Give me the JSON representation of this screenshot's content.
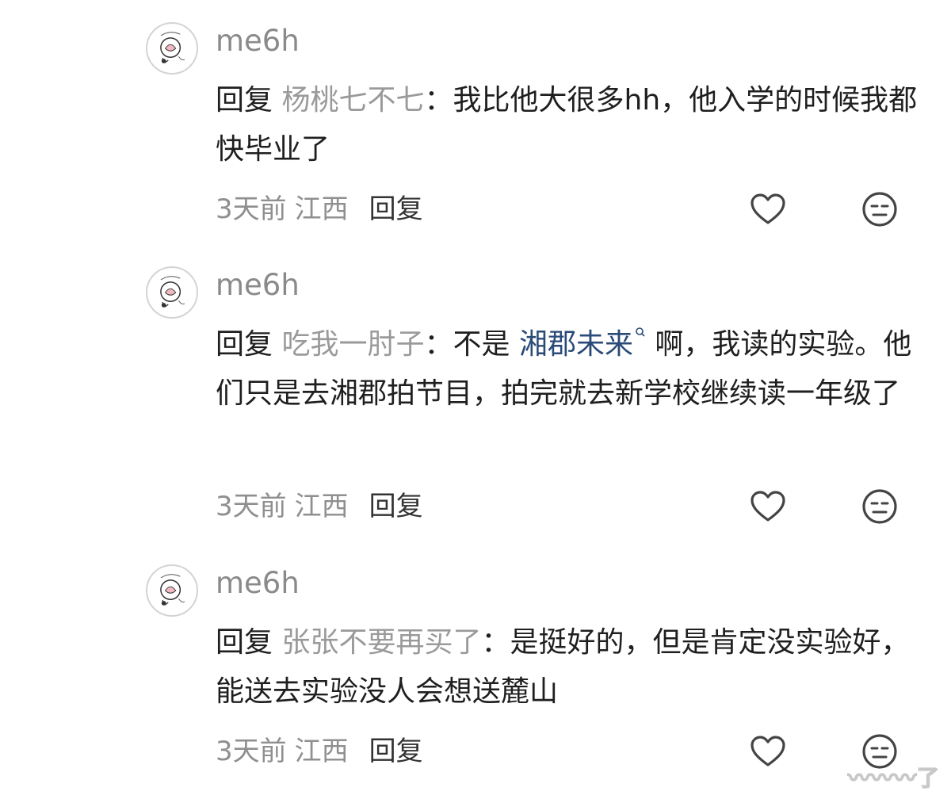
{
  "comments": [
    {
      "username": "me6h",
      "reply_word": "回复",
      "reply_target": "杨桃七不七",
      "colon": "：",
      "text_before": "我比他大很多hh，他入学的时候我都快毕业了",
      "link_text": "",
      "text_after": "",
      "time": "3天前",
      "location": "江西",
      "reply_label": "回复",
      "like_icon": "heart-icon",
      "reaction_icon": "meh-face-icon"
    },
    {
      "username": "me6h",
      "reply_word": "回复",
      "reply_target": "吃我一肘子",
      "colon": "：",
      "text_before": "不是 ",
      "link_text": "湘郡未来",
      "text_after": " 啊，我读的实验。他们只是去湘郡拍节目，拍完就去新学校继续读一年级了",
      "time": "3天前",
      "location": "江西",
      "reply_label": "回复",
      "like_icon": "heart-icon",
      "reaction_icon": "meh-face-icon"
    },
    {
      "username": "me6h",
      "reply_word": "回复",
      "reply_target": "张张不要再买了",
      "colon": "：",
      "text_before": "是挺好的，但是肯定没实验好，能送去实验没人会想送麓山",
      "link_text": "",
      "text_after": "",
      "time": "3天前",
      "location": "江西",
      "reply_label": "回复",
      "like_icon": "heart-icon",
      "reaction_icon": "meh-face-icon"
    }
  ],
  "colors": {
    "link": "#2a4a78",
    "muted": "#8f8f8f",
    "text": "#1f1f1f"
  }
}
